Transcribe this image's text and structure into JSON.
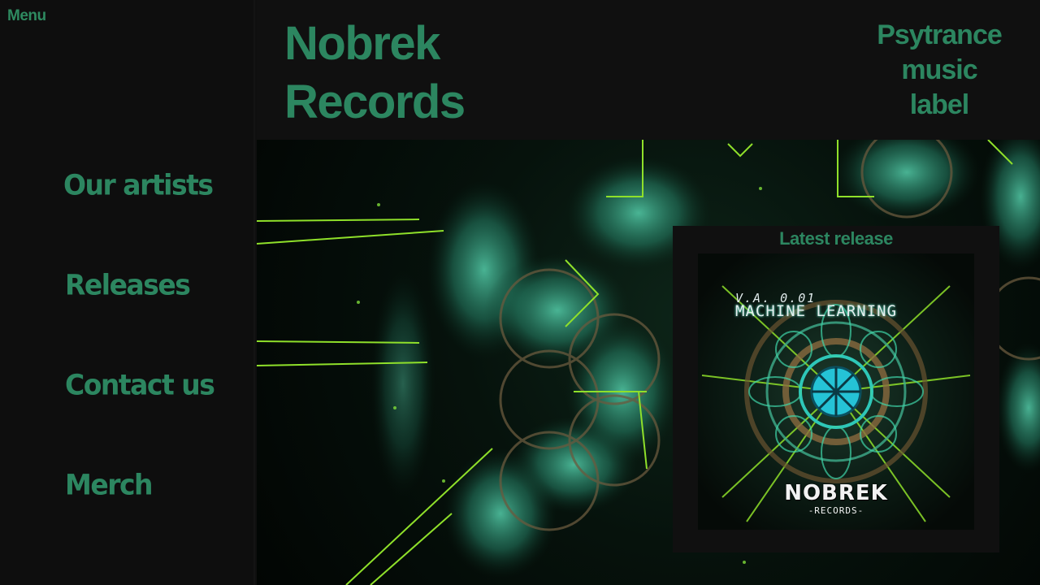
{
  "sidebar": {
    "menu_label": "Menu",
    "items": [
      {
        "label": "Our artists"
      },
      {
        "label": "Releases"
      },
      {
        "label": "Contact us"
      },
      {
        "label": "Merch"
      }
    ]
  },
  "header": {
    "title": "Nobrek Records",
    "tagline": "Psytrance music label"
  },
  "latest_release": {
    "heading": "Latest release",
    "cover": {
      "va": "V.A. 0.01",
      "album": "MACHINE LEARNING",
      "brand": "NOBREK",
      "sub": "-RECORDS-"
    }
  },
  "colors": {
    "accent": "#2c8660",
    "background": "#0f0f0f",
    "hero_glow": "#48d9b0",
    "hero_lines": "#8fe02a"
  }
}
